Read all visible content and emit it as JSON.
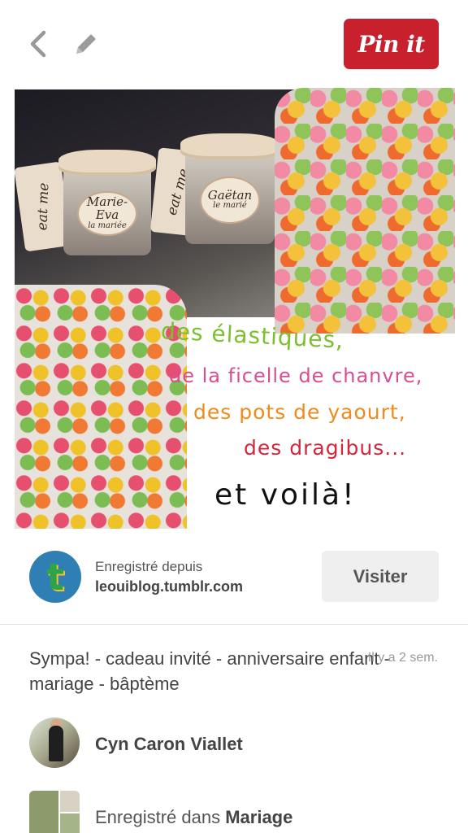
{
  "header": {
    "pin_button_label": "Pin it"
  },
  "image": {
    "jar_tags": [
      "eat me",
      "eat me"
    ],
    "jar_labels": [
      {
        "name": "Marie-Eva",
        "sub": "la mariée"
      },
      {
        "name": "Gaëtan",
        "sub": "le marié"
      }
    ],
    "caption_lines": [
      "des élastiques,",
      "de la ficelle de chanvre,",
      "des pots de yaourt,",
      "des dragibus...",
      "et voilà!"
    ],
    "caption_colors": [
      "#7cbf2f",
      "#d84d93",
      "#f08a1b",
      "#d6243a",
      "#111111"
    ]
  },
  "source": {
    "saved_from_label": "Enregistré depuis",
    "domain": "leouiblog.tumblr.com",
    "avatar_letter": "t",
    "visit_label": "Visiter"
  },
  "pin": {
    "description": "Sympa! - cadeau invité - anniversaire enfant - mariage - bâptème",
    "time_ago": "Il y a 2 sem."
  },
  "pinner": {
    "name": "Cyn Caron Viallet"
  },
  "board": {
    "prefix": "Enregistré dans",
    "name": "Mariage"
  },
  "colors": {
    "pin_red": "#c8202d",
    "visit_bg": "#efefef"
  }
}
